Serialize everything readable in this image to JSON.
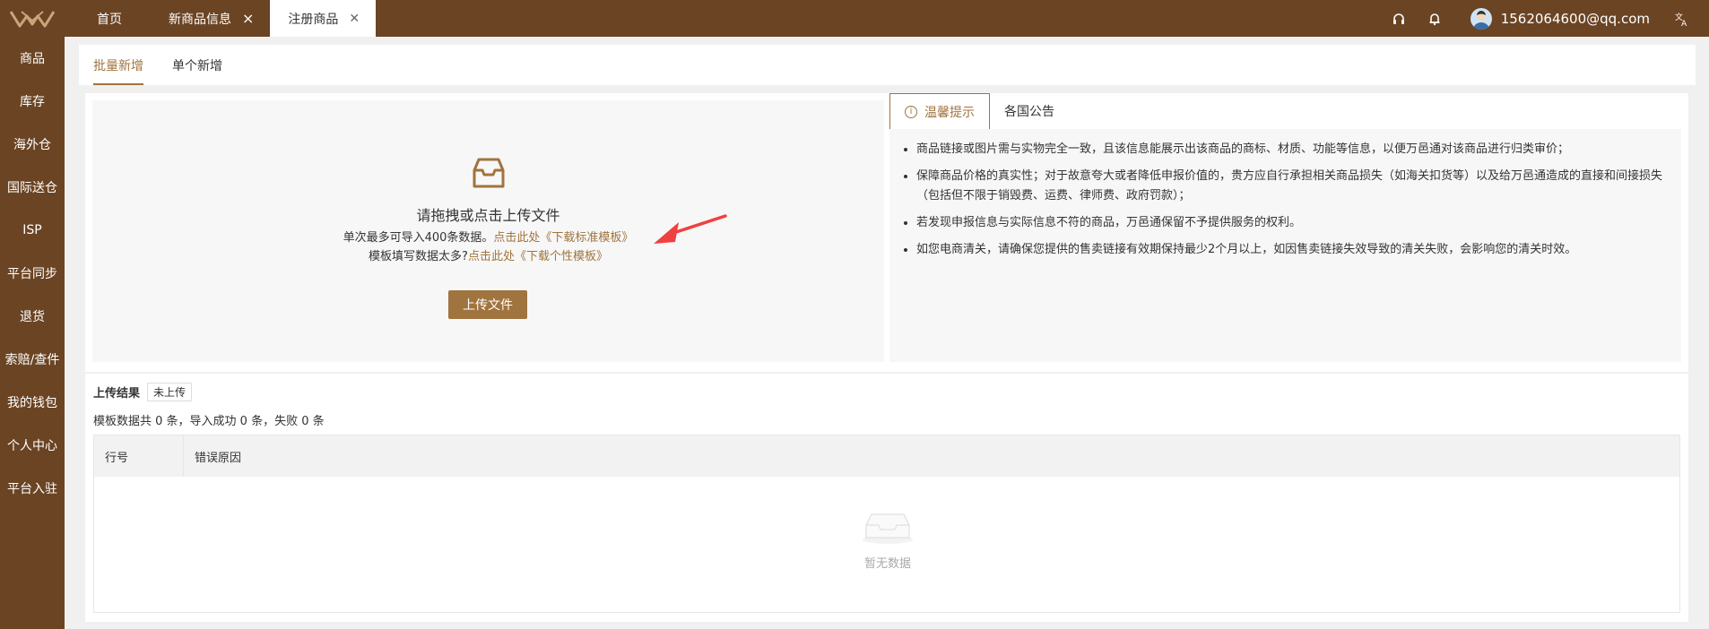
{
  "header": {
    "tabs": [
      {
        "label": "首页"
      },
      {
        "label": "新商品信息"
      },
      {
        "label": "注册商品"
      }
    ],
    "user_email": "1562064600@qq.com",
    "icons": [
      "headset-icon",
      "bell-icon",
      "translate-icon"
    ]
  },
  "sidebar": {
    "items": [
      {
        "label": "商品"
      },
      {
        "label": "库存"
      },
      {
        "label": "海外仓"
      },
      {
        "label": "国际送仓"
      },
      {
        "label": "ISP"
      },
      {
        "label": "平台同步"
      },
      {
        "label": "退货"
      },
      {
        "label": "索赔/查件"
      },
      {
        "label": "我的钱包"
      },
      {
        "label": "个人中心"
      },
      {
        "label": "平台入驻"
      }
    ]
  },
  "subtabs": [
    {
      "label": "批量新增"
    },
    {
      "label": "单个新增"
    }
  ],
  "upload": {
    "title": "请拖拽或点击上传文件",
    "line1_text": "单次最多可导入400条数据。",
    "line1_link": "点击此处《下载标准模板》",
    "line2_text": "模板填写数据太多?",
    "line2_link": "点击此处《下载个性模板》",
    "button": "上传文件"
  },
  "notice": {
    "tabs": [
      {
        "label": "温馨提示"
      },
      {
        "label": "各国公告"
      }
    ],
    "items": [
      "商品链接或图片需与实物完全一致，且该信息能展示出该商品的商标、材质、功能等信息，以便万邑通对该商品进行归类审价；",
      "保障商品价格的真实性；对于故意夸大或者降低申报价值的，贵方应自行承担相关商品损失（如海关扣货等）以及给万邑通造成的直接和间接损失（包括但不限于销毁费、运费、律师费、政府罚款）；",
      "若发现申报信息与实际信息不符的商品，万邑通保留不予提供服务的权利。",
      "如您电商清关，请确保您提供的售卖链接有效期保持最少2个月以上，如因售卖链接失效导致的清关失败，会影响您的清关时效。"
    ]
  },
  "results": {
    "title": "上传结果",
    "badge": "未上传",
    "summary": "模板数据共 0 条，导入成功 0 条，失败 0 条",
    "columns": [
      "行号",
      "错误原因"
    ],
    "empty_text": "暂无数据"
  },
  "colors": {
    "brand": "#6b4423",
    "accent": "#a0743e",
    "arrow": "#f04040"
  }
}
